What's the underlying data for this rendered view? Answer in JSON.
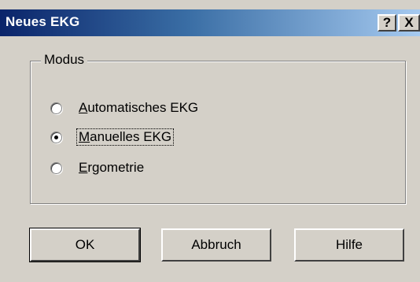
{
  "dialog": {
    "title": "Neues EKG",
    "help_button_label": "?",
    "close_button_label": "X"
  },
  "group": {
    "legend": "Modus",
    "options": [
      {
        "accel": "A",
        "rest": "utomatisches EKG",
        "selected": false
      },
      {
        "accel": "M",
        "rest": "anuelles EKG",
        "selected": true
      },
      {
        "accel": "E",
        "rest": "rgometrie",
        "selected": false
      }
    ]
  },
  "buttons": {
    "ok": "OK",
    "cancel": "Abbruch",
    "help": "Hilfe"
  },
  "colors": {
    "title_gradient_start": "#0a246a",
    "title_gradient_end": "#a6caf0",
    "face": "#d4d0c8"
  }
}
